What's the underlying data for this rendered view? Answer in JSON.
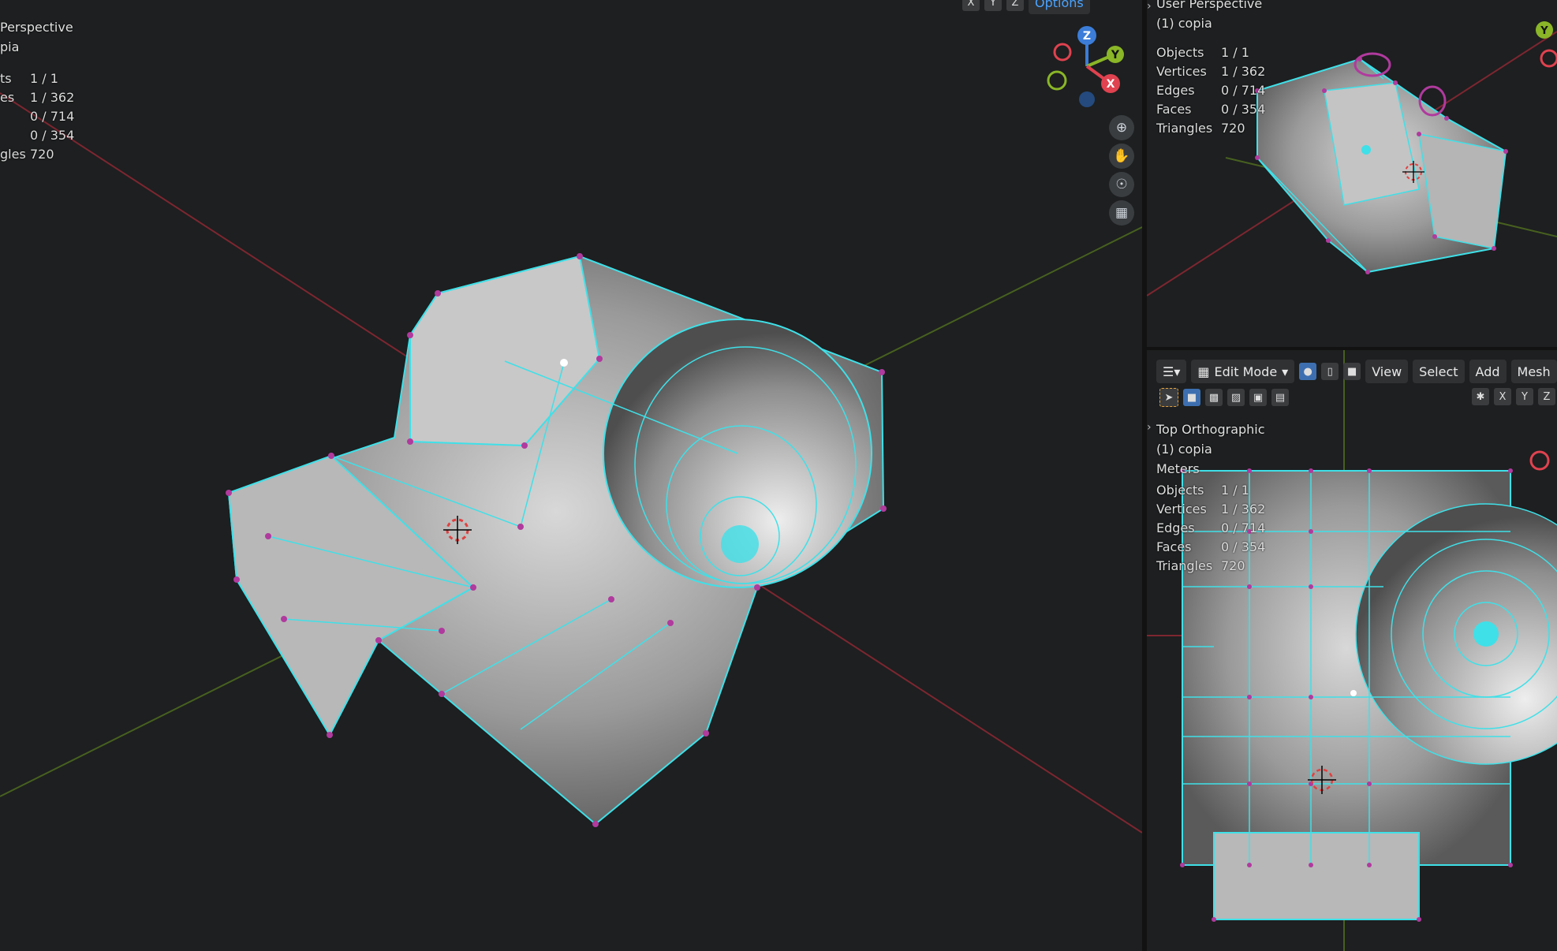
{
  "left_viewport": {
    "header": {
      "view_name": "Perspective",
      "object_name": "pia"
    },
    "stats": [
      {
        "label": "ts",
        "value": "1 / 1"
      },
      {
        "label": "es",
        "value": "1 / 362"
      },
      {
        "label": "",
        "value": "0 / 714"
      },
      {
        "label": "",
        "value": "0 / 354"
      },
      {
        "label": "gles",
        "value": "720"
      }
    ],
    "gizmo": {
      "x_label": "X",
      "y_label": "Y",
      "z_label": "Z"
    },
    "nav_icons": [
      "zoom-icon",
      "hand-pan-icon",
      "camera-icon",
      "grid-ortho-icon"
    ],
    "top_menu": {
      "options_label": "Options",
      "xyz": [
        "X",
        "Y",
        "Z"
      ]
    }
  },
  "top_right_viewport": {
    "header": {
      "view_name": "User Perspective",
      "object_name": "(1) copia"
    },
    "stats": [
      {
        "label": "Objects",
        "value": "1 / 1"
      },
      {
        "label": "Vertices",
        "value": "1 / 362"
      },
      {
        "label": "Edges",
        "value": "0 / 714"
      },
      {
        "label": "Faces",
        "value": "0 / 354"
      },
      {
        "label": "Triangles",
        "value": "720"
      }
    ],
    "gizmo_y_label": "Y"
  },
  "bottom_right_viewport": {
    "toolbar": {
      "mode_label": "Edit Mode",
      "menus": [
        "View",
        "Select",
        "Add",
        "Mesh"
      ],
      "xyz": [
        "X",
        "Y",
        "Z"
      ]
    },
    "header": {
      "view_name": "Top Orthographic",
      "object_name": "(1) copia",
      "units": "Meters"
    },
    "stats": [
      {
        "label": "Objects",
        "value": "1 / 1"
      },
      {
        "label": "Vertices",
        "value": "1 / 362"
      },
      {
        "label": "Edges",
        "value": "0 / 714"
      },
      {
        "label": "Faces",
        "value": "0 / 354"
      },
      {
        "label": "Triangles",
        "value": "720"
      }
    ]
  },
  "colors": {
    "background": "#1d1f20",
    "mesh_edge": "#3fe0e8",
    "mesh_vertex": "#b03a9e",
    "axis_x": "#8e2b34",
    "axis_y": "#4e6b22",
    "gizmo_x": "#e0424f",
    "gizmo_y": "#8ab627",
    "gizmo_z": "#3b7dd8"
  }
}
